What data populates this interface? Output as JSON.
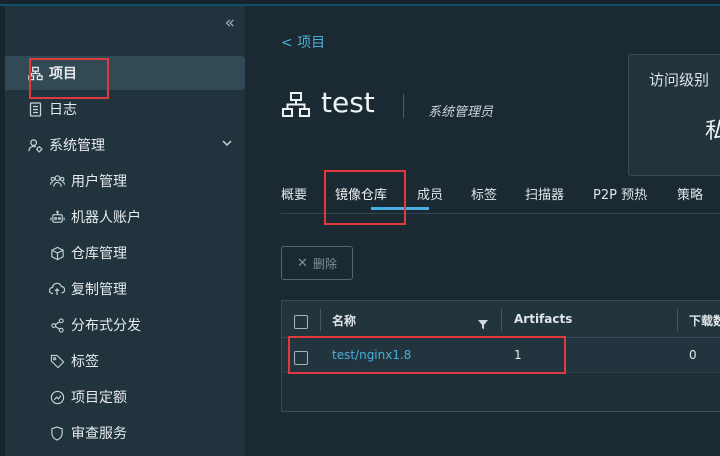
{
  "sidebar": {
    "collapse_glyph": "«",
    "items": [
      {
        "label": "项目",
        "icon": "project-icon"
      },
      {
        "label": "日志",
        "icon": "log-icon"
      },
      {
        "label": "系统管理",
        "icon": "admin-icon"
      },
      {
        "label": "用户管理",
        "icon": "users-icon"
      },
      {
        "label": "机器人账户",
        "icon": "robot-icon"
      },
      {
        "label": "仓库管理",
        "icon": "registry-icon"
      },
      {
        "label": "复制管理",
        "icon": "replication-icon"
      },
      {
        "label": "分布式分发",
        "icon": "share-icon"
      },
      {
        "label": "标签",
        "icon": "tag-icon"
      },
      {
        "label": "项目定额",
        "icon": "quota-icon"
      },
      {
        "label": "审查服务",
        "icon": "shield-icon"
      }
    ]
  },
  "main": {
    "back_label": "<  项目",
    "title": "test",
    "role": "系统管理员",
    "access_card": {
      "label": "访问级别",
      "value": "私"
    },
    "tabs": [
      "概要",
      "镜像仓库",
      "成员",
      "标签",
      "扫描器",
      "P2P 预热",
      "策略"
    ],
    "active_tab": "镜像仓库",
    "delete_label": "删除",
    "table": {
      "headers": [
        "名称",
        "Artifacts",
        "下载数"
      ],
      "rows": [
        {
          "name": "test/nginx1.8",
          "artifacts": "1",
          "pulls": "0"
        }
      ]
    }
  },
  "colors": {
    "accent": "#49aee0",
    "highlight": "#e0393e",
    "sidebar": "#21333c",
    "background": "#1b2a32"
  }
}
